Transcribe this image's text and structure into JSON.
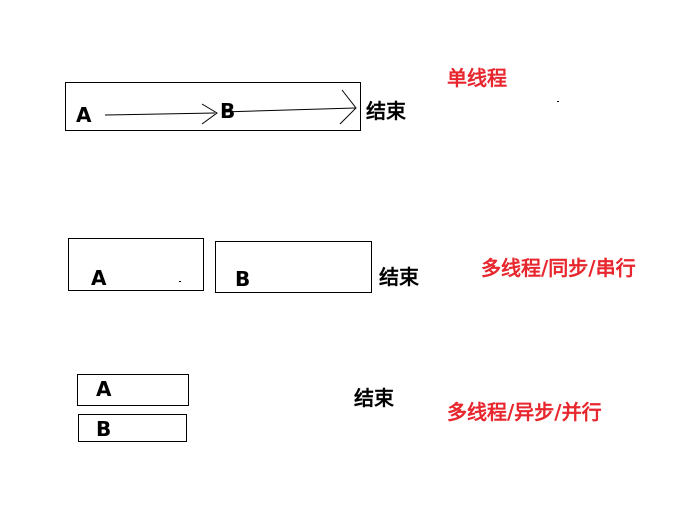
{
  "colors": {
    "caption": "#e8262e",
    "ink": "#000000"
  },
  "row1": {
    "caption": "单线程",
    "a": "A",
    "b": "B",
    "end": "结束"
  },
  "row2": {
    "caption": "多线程/同步/串行",
    "a": "A",
    "b": "B",
    "end": "结束"
  },
  "row3": {
    "caption": "多线程/异步/并行",
    "a": "A",
    "b": "B",
    "end": "结束"
  }
}
